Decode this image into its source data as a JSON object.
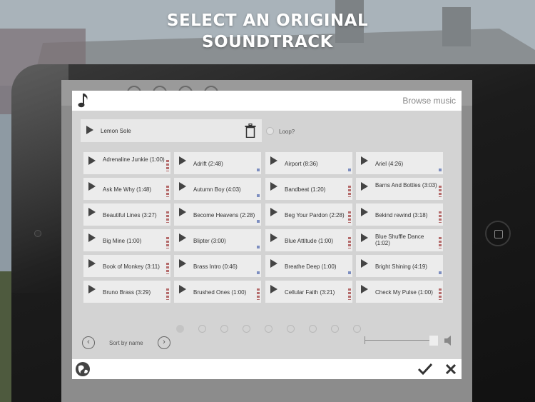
{
  "headline": {
    "line1": "SELECT AN ORIGINAL",
    "line2": "SOUNDTRACK"
  },
  "dialog": {
    "browse_label": "Browse music",
    "selected_track": "Lemon Sole",
    "loop_label": "Loop?",
    "sort_label": "Sort by name",
    "page_count": 9,
    "current_page": 1,
    "volume_level": 0.95
  },
  "tracks": [
    {
      "name": "Adrenaline Junkie (1:00)",
      "tag": "red"
    },
    {
      "name": "Adrift (2:48)",
      "tag": "blue"
    },
    {
      "name": "Airport (8:36)",
      "tag": "blue"
    },
    {
      "name": "Ariel (4:26)",
      "tag": "blue"
    },
    {
      "name": "Ask Me Why (1:48)",
      "tag": "red"
    },
    {
      "name": "Autumn Boy (4:03)",
      "tag": "blue"
    },
    {
      "name": "Bandbeat (1:20)",
      "tag": "red"
    },
    {
      "name": "Barns And Bottles (3:03)",
      "tag": "red"
    },
    {
      "name": "Beautiful Lines (3:27)",
      "tag": "red"
    },
    {
      "name": "Become Heavens (2:28)",
      "tag": "blue"
    },
    {
      "name": "Beg Your Pardon (2:28)",
      "tag": "red"
    },
    {
      "name": "Bekind rewind (3:18)",
      "tag": "red"
    },
    {
      "name": "Big Mine (1:00)",
      "tag": "red"
    },
    {
      "name": "Blipter (3:00)",
      "tag": "blue"
    },
    {
      "name": "Blue Attitude (1:00)",
      "tag": "red"
    },
    {
      "name": "Blue Shuffle Dance (1:02)",
      "tag": "red"
    },
    {
      "name": "Book of Monkey (3:11)",
      "tag": "red"
    },
    {
      "name": "Brass Intro (0:46)",
      "tag": "blue"
    },
    {
      "name": "Breathe Deep (1:00)",
      "tag": "blue"
    },
    {
      "name": "Bright Shining (4:19)",
      "tag": "blue"
    },
    {
      "name": "Bruno Brass (3:29)",
      "tag": "red"
    },
    {
      "name": "Brushed Ones (1:00)",
      "tag": "red"
    },
    {
      "name": "Cellular Faith (3:21)",
      "tag": "red"
    },
    {
      "name": "Check My Pulse (1:00)",
      "tag": "red"
    }
  ],
  "icons": {
    "note": "music-note-icon",
    "trash": "trash-icon",
    "play": "play-icon",
    "prev": "chevron-left-icon",
    "next": "chevron-right-icon",
    "speaker": "speaker-icon",
    "globe": "globe-icon",
    "confirm": "checkmark-icon",
    "cancel": "close-icon"
  },
  "colors": {
    "tag_red": "#b56b6b",
    "tag_blue": "#7d8ec0",
    "dialog_bg": "#d3d3d3",
    "tile_bg": "#ececec"
  }
}
